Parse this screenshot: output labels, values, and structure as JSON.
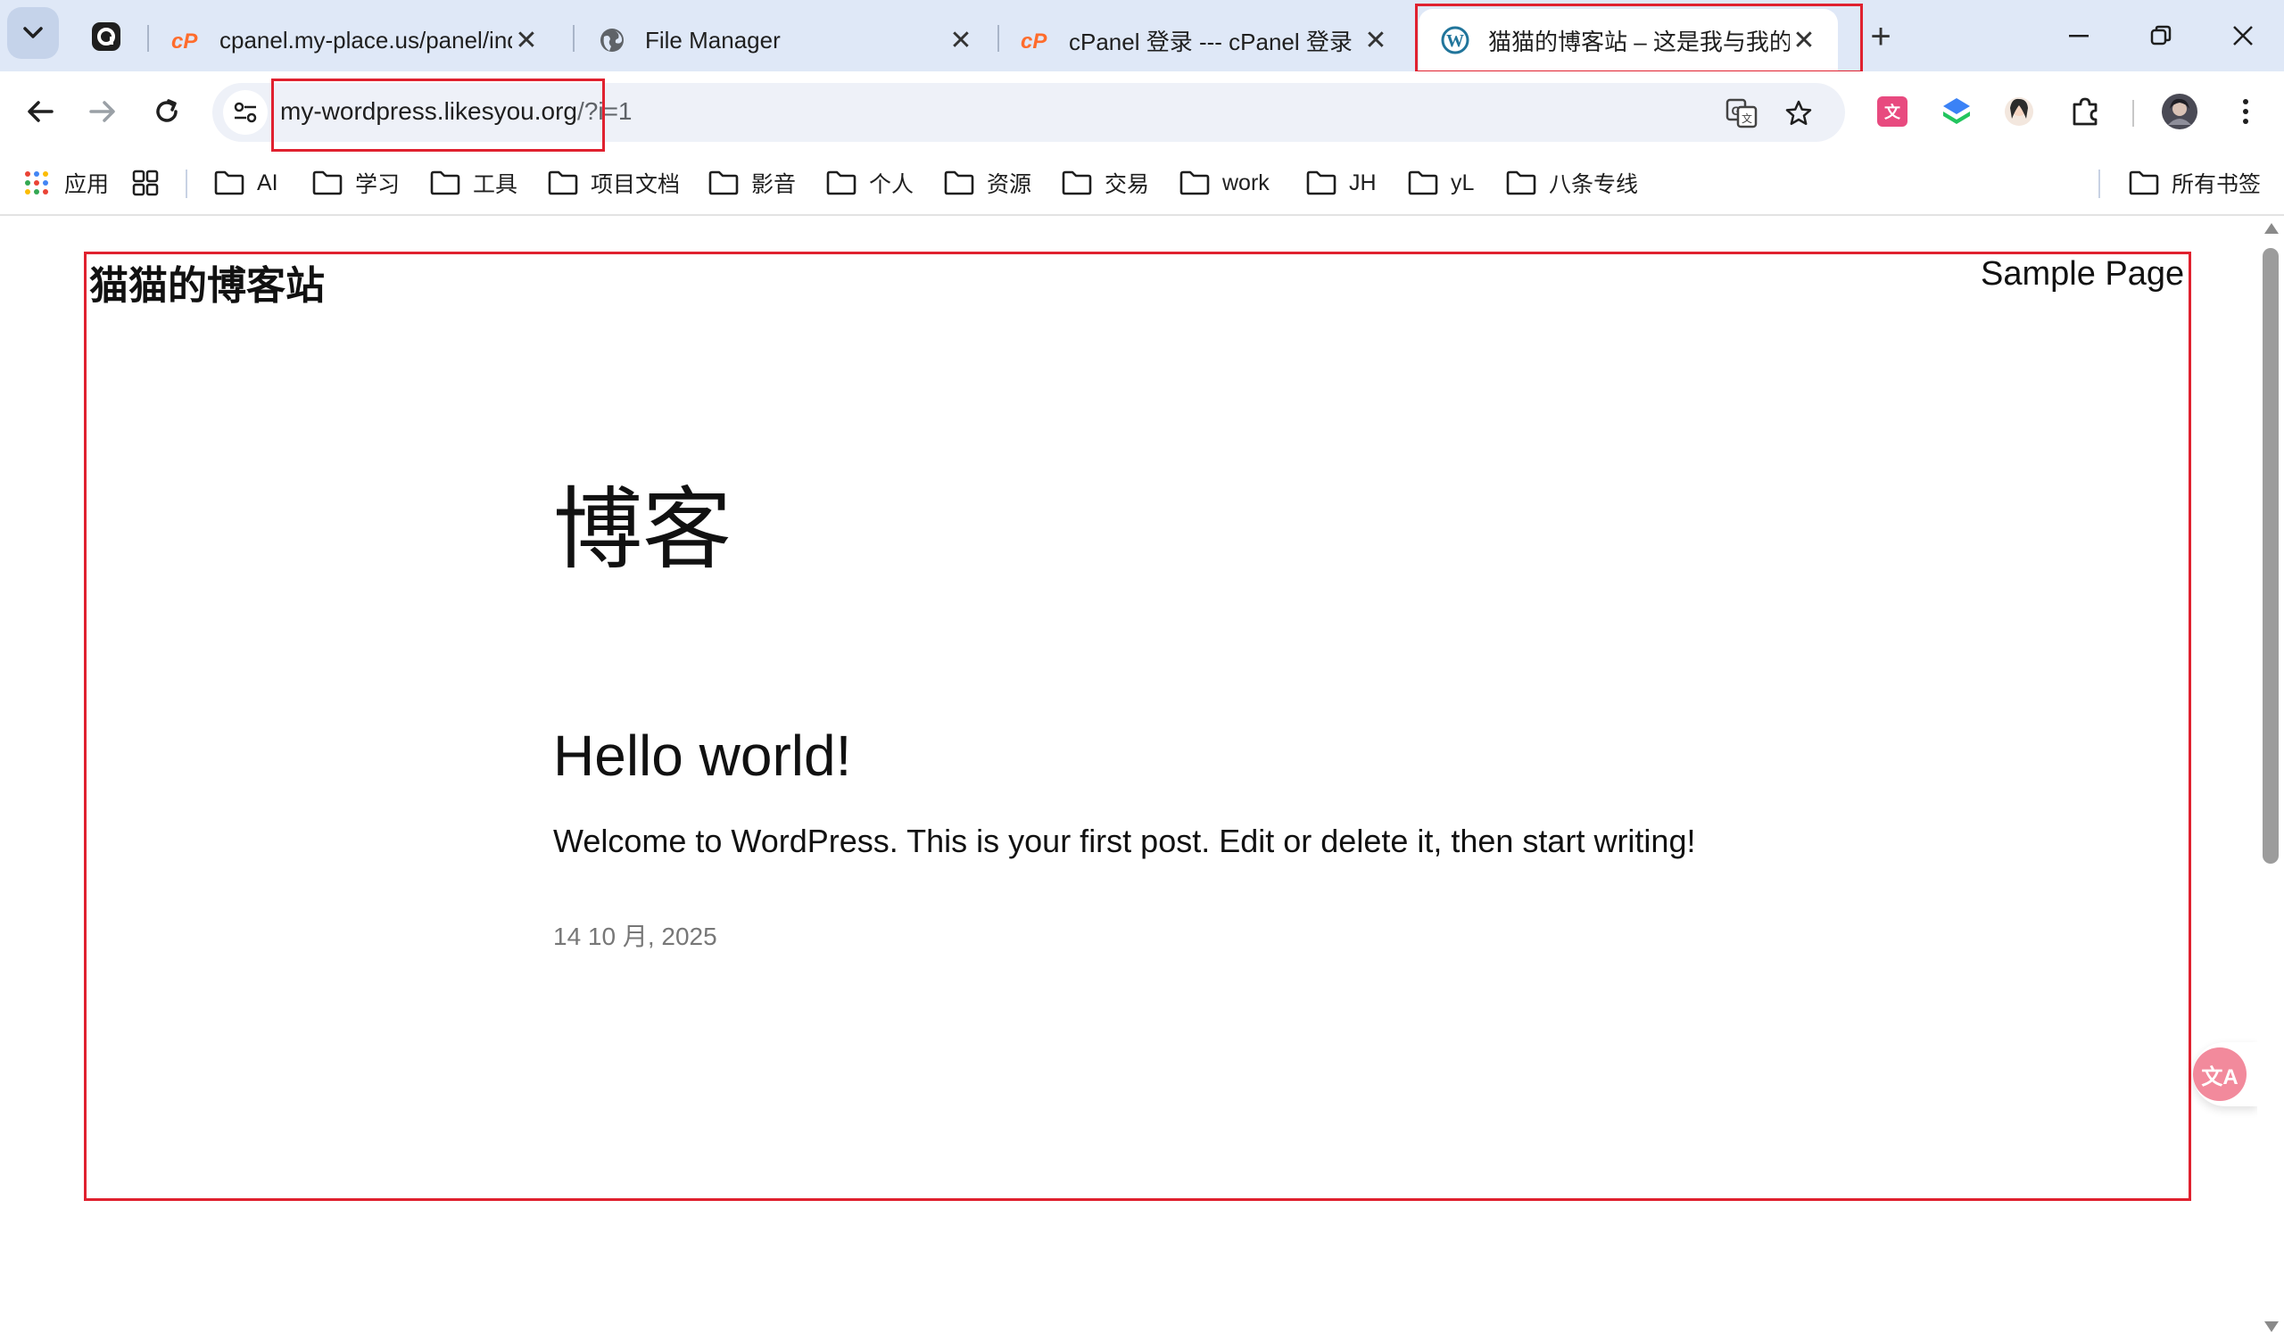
{
  "tabs": [
    {
      "title": "cpanel.my-place.us/panel/index",
      "favicon": "cpanel-icon"
    },
    {
      "title": "File Manager",
      "favicon": "globe-icon"
    },
    {
      "title": "cPanel 登录 --- cPanel 登录",
      "favicon": "cpanel-icon"
    },
    {
      "title": "猫猫的博客站 – 这是我与我的猫",
      "favicon": "wordpress-icon",
      "active": true
    }
  ],
  "new_tab_label": "+",
  "address_bar": {
    "url_host": "my-wordpress.likesyou.org",
    "url_rest": "/?i=1"
  },
  "bookmarks": {
    "apps_label": "应用",
    "items": [
      "AI",
      "学习",
      "工具",
      "项目文档",
      "影音",
      "个人",
      "资源",
      "交易",
      "work",
      "JH",
      "yL",
      "八条专线"
    ],
    "all_bookmarks_label": "所有书签"
  },
  "site": {
    "title": "猫猫的博客站",
    "nav_link": "Sample Page",
    "blog_heading": "博客",
    "post": {
      "title": "Hello world!",
      "excerpt": "Welcome to WordPress. This is your first post. Edit or delete it, then start writing!",
      "date": "14 10 月, 2025"
    }
  },
  "translate_fab_label": "文A",
  "colors": {
    "tabstrip_bg": "#dfe8f7",
    "omnibox_bg": "#eef1f8",
    "highlight": "#e0212f",
    "cpanel_orange": "#ff6c2c",
    "wordpress_blue": "#21759b"
  }
}
